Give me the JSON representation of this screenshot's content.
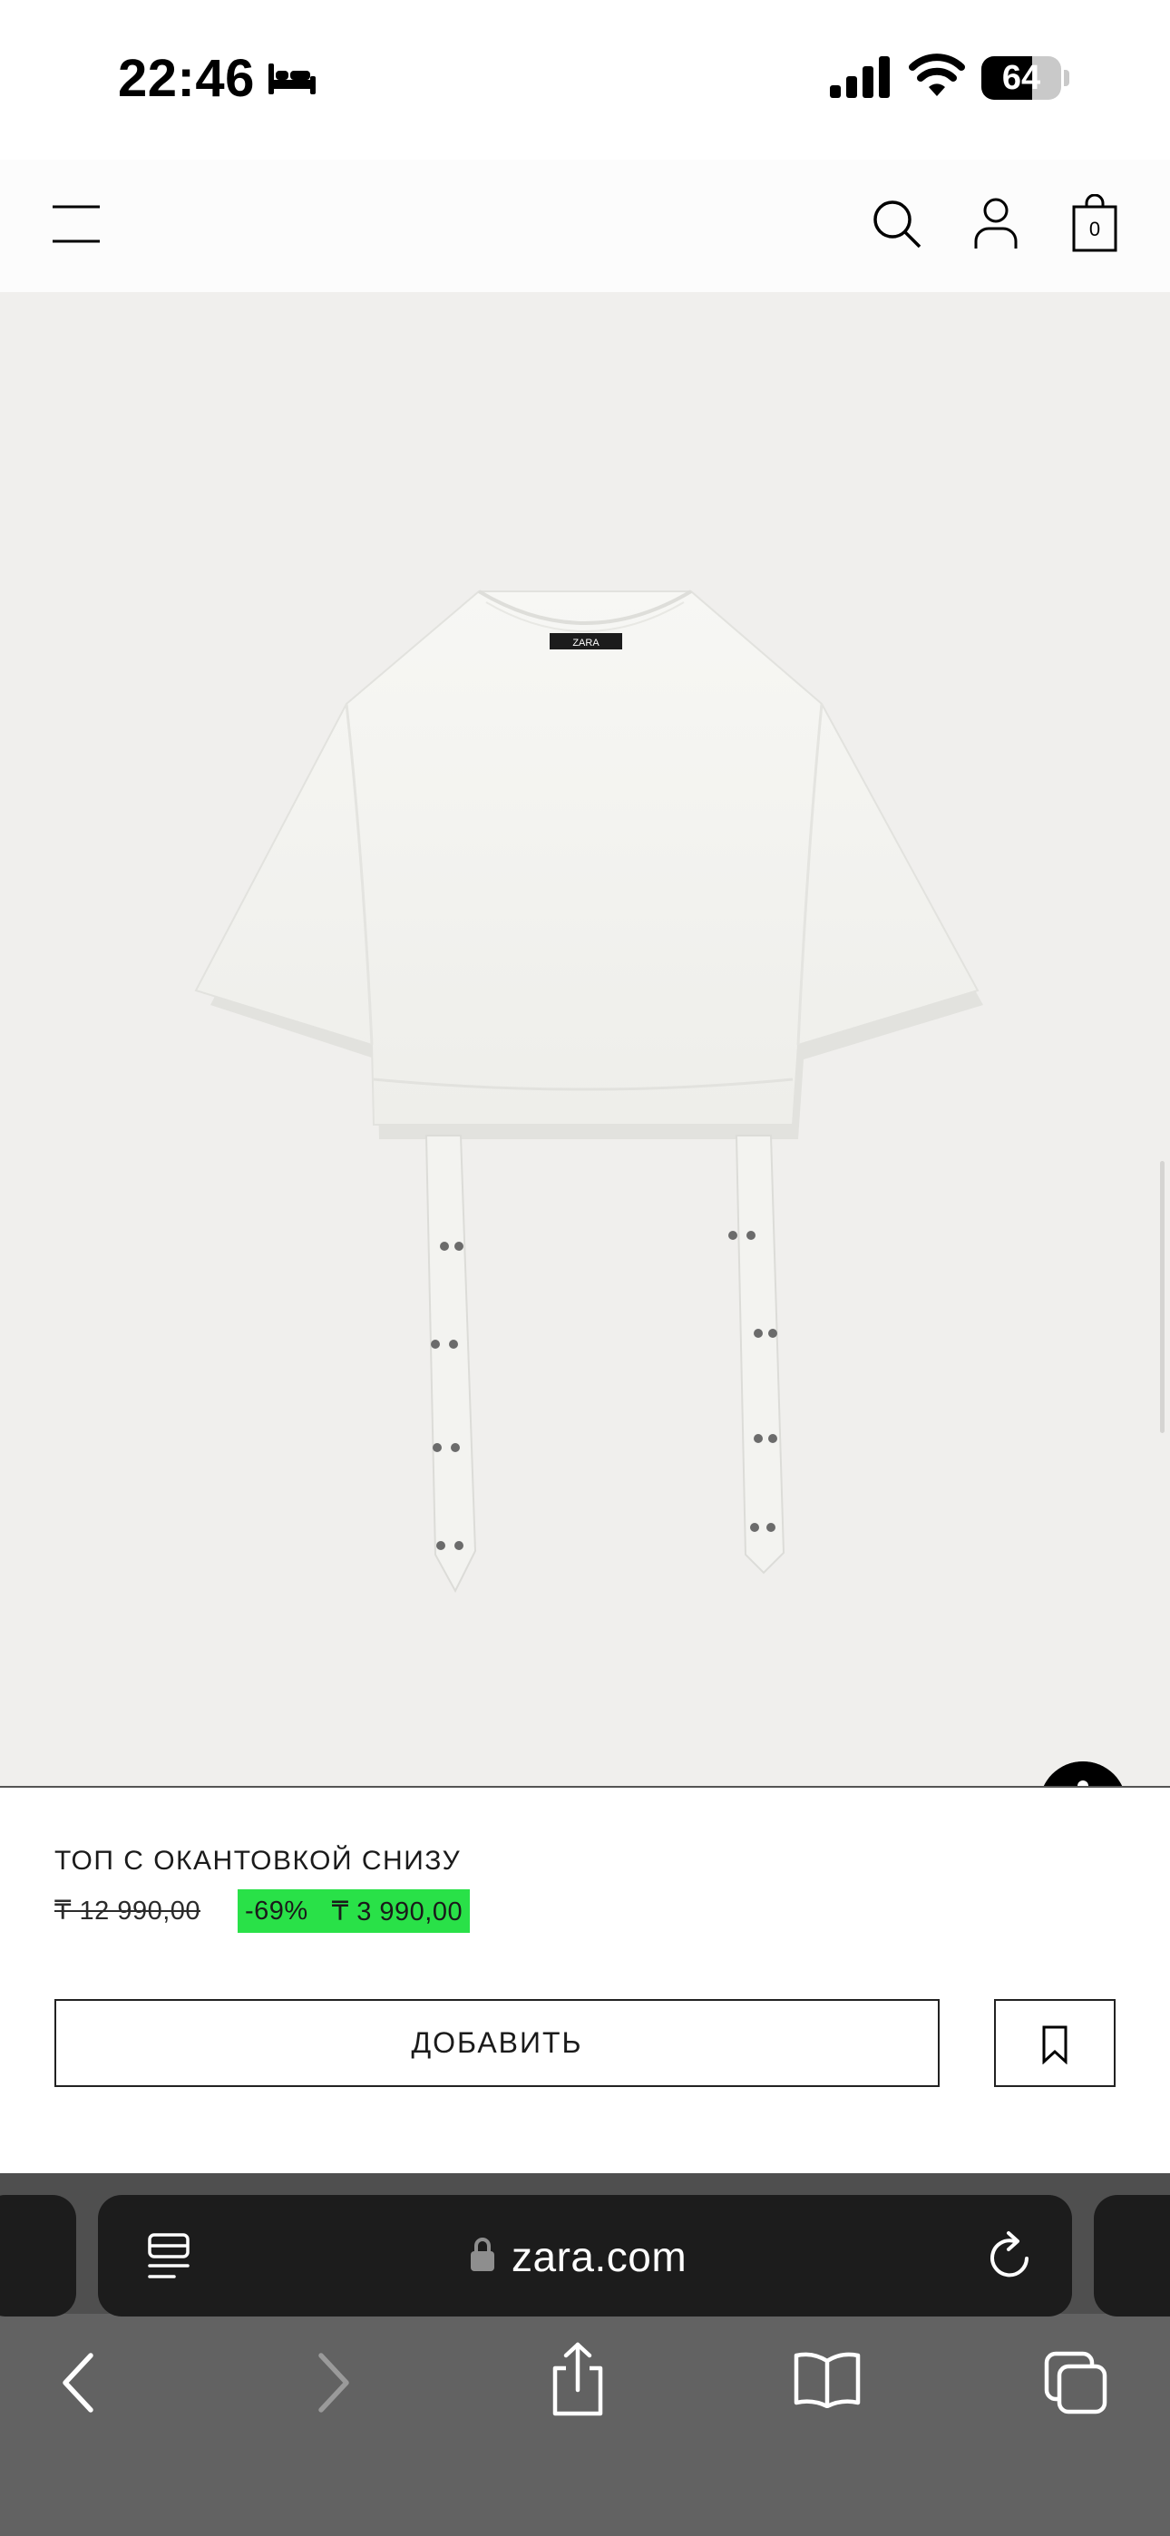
{
  "status_bar": {
    "time": "22:46",
    "battery_level": "64",
    "battery_fraction": 0.64,
    "icons": [
      "bed-icon",
      "signal-icon",
      "wifi-icon",
      "battery-icon"
    ]
  },
  "header": {
    "bag_count": "0",
    "icons": [
      "menu-icon",
      "search-icon",
      "account-icon",
      "bag-icon"
    ]
  },
  "product": {
    "name": "ТОП С ОКАНТОВКОЙ СНИЗУ",
    "old_price": "₸ 12 990,00",
    "discount": "-69%",
    "sale_price": "₸ 3 990,00",
    "add_label": "ДОБАВИТЬ",
    "image_label": "ZARA"
  },
  "browser": {
    "url": "zara.com",
    "icons": [
      "reader-icon",
      "lock-icon",
      "reload-icon",
      "back-icon",
      "forward-icon",
      "share-icon",
      "bookmarks-icon",
      "tabs-icon"
    ]
  },
  "colors": {
    "sale_badge": "#29e148",
    "image_background": "#f0efed",
    "safari_toolbar": "#626262",
    "address_bar": "#1c1c1c"
  }
}
